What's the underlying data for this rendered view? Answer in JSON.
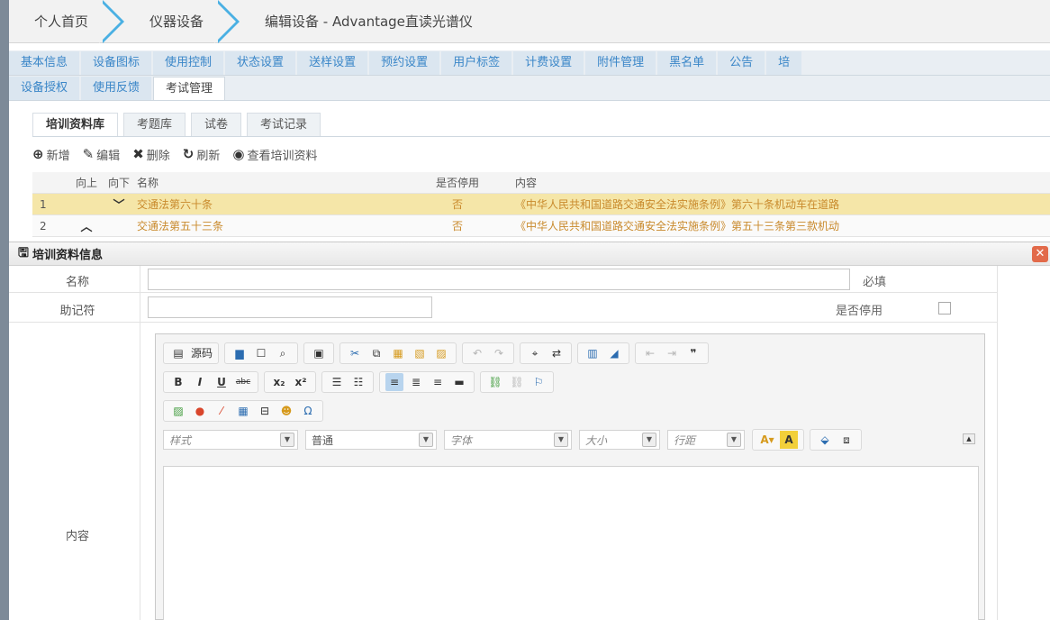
{
  "breadcrumb": [
    "个人首页",
    "仪器设备",
    "编辑设备 - Advantage直读光谱仪"
  ],
  "tabs_row1": [
    "基本信息",
    "设备图标",
    "使用控制",
    "状态设置",
    "送样设置",
    "预约设置",
    "用户标签",
    "计费设置",
    "附件管理",
    "黑名单",
    "公告",
    "培"
  ],
  "tabs_row2": [
    "设备授权",
    "使用反馈",
    "考试管理"
  ],
  "tabs_row2_active": "考试管理",
  "inner_tabs": [
    "培训资料库",
    "考题库",
    "试卷",
    "考试记录"
  ],
  "inner_tabs_active": "培训资料库",
  "toolbar": {
    "add": "新增",
    "edit": "编辑",
    "delete": "删除",
    "refresh": "刷新",
    "view": "查看培训资料"
  },
  "grid": {
    "headers": {
      "up": "向上",
      "down": "向下",
      "name": "名称",
      "stop": "是否停用",
      "content": "内容"
    },
    "rows": [
      {
        "num": "1",
        "name": "交通法第六十条",
        "stop": "否",
        "content": "《中华人民共和国道路交通安全法实施条例》第六十条机动车在道路"
      },
      {
        "num": "2",
        "name": "交通法第五十三条",
        "stop": "否",
        "content": "《中华人民共和国道路交通安全法实施条例》第五十三条第三款机动"
      }
    ]
  },
  "dialog": {
    "title": "培训资料信息",
    "name_label": "名称",
    "required": "必填",
    "mnemonic_label": "助记符",
    "stop_label": "是否停用",
    "content_label": "内容",
    "name_value": "",
    "mnemonic_value": ""
  },
  "editor": {
    "source_label": "源码",
    "combos": {
      "style": "样式",
      "format": "普通",
      "font": "字体",
      "size": "大小",
      "lineheight": "行距"
    },
    "superscript": "x²",
    "subscript": "x₂",
    "strike": "abc"
  }
}
